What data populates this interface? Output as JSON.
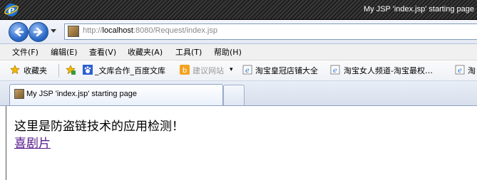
{
  "window": {
    "title": "My JSP 'index.jsp' starting page"
  },
  "address_bar": {
    "prefix": "http://",
    "host": "localhost",
    "rest": ":8080/Request/index.jsp"
  },
  "menu": {
    "items": [
      "文件(F)",
      "编辑(E)",
      "查看(V)",
      "收藏夹(A)",
      "工具(T)",
      "帮助(H)"
    ]
  },
  "favorites": {
    "label": "收藏夹",
    "items": [
      "_文库合作_百度文库",
      "建议网站",
      "淘宝皇冠店铺大全",
      "淘宝女人频道-淘宝最权…",
      "淘"
    ]
  },
  "tabs": {
    "active_label": "My JSP 'index.jsp' starting page"
  },
  "page": {
    "text": "这里是防盗链技术的应用检测！",
    "link": "喜剧片"
  },
  "colors": {
    "link": "#551a8b",
    "titlebar": "#2a2a2a"
  }
}
